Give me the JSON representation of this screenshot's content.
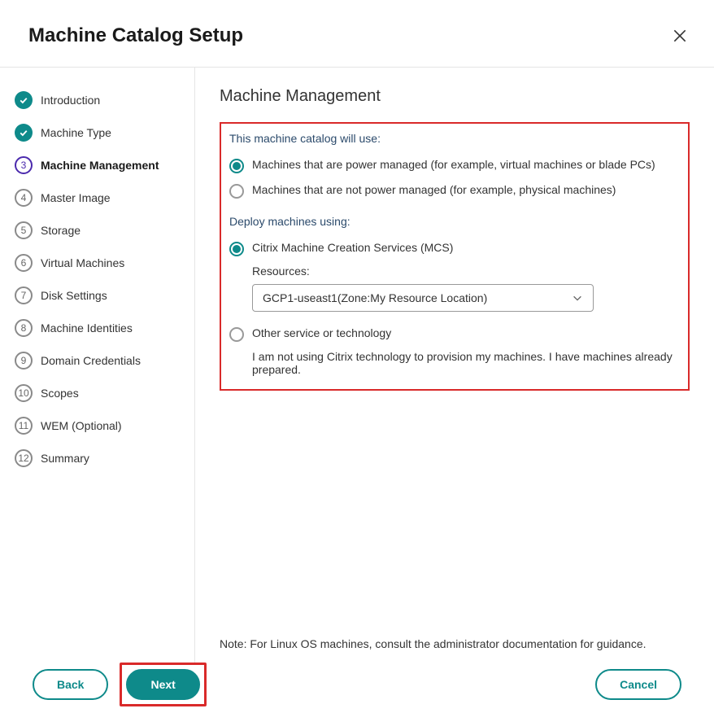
{
  "header": {
    "title": "Machine Catalog Setup"
  },
  "sidebar": {
    "steps": [
      {
        "label": "Introduction",
        "state": "done"
      },
      {
        "label": "Machine Type",
        "state": "done"
      },
      {
        "label": "Machine Management",
        "state": "current"
      },
      {
        "label": "Master Image",
        "state": "pending",
        "num": "4"
      },
      {
        "label": "Storage",
        "state": "pending",
        "num": "5"
      },
      {
        "label": "Virtual Machines",
        "state": "pending",
        "num": "6"
      },
      {
        "label": "Disk Settings",
        "state": "pending",
        "num": "7"
      },
      {
        "label": "Machine Identities",
        "state": "pending",
        "num": "8"
      },
      {
        "label": "Domain Credentials",
        "state": "pending",
        "num": "9"
      },
      {
        "label": "Scopes",
        "state": "pending",
        "num": "10"
      },
      {
        "label": "WEM (Optional)",
        "state": "pending",
        "num": "11"
      },
      {
        "label": "Summary",
        "state": "pending",
        "num": "12"
      }
    ],
    "current_num": "3"
  },
  "content": {
    "heading": "Machine Management",
    "use_label": "This machine catalog will use:",
    "use_options": {
      "power_managed": "Machines that are power managed (for example, virtual machines or blade PCs)",
      "not_power_managed": "Machines that are not power managed (for example, physical machines)"
    },
    "deploy_label": "Deploy machines using:",
    "deploy_options": {
      "mcs": "Citrix Machine Creation Services (MCS)",
      "resources_label": "Resources:",
      "resources_value": "GCP1-useast1(Zone:My Resource Location)",
      "other": "Other service or technology",
      "other_desc": "I am not using Citrix technology to provision my machines. I have machines already prepared."
    },
    "note": "Note: For Linux OS machines, consult the administrator documentation for guidance."
  },
  "footer": {
    "back": "Back",
    "next": "Next",
    "cancel": "Cancel"
  }
}
